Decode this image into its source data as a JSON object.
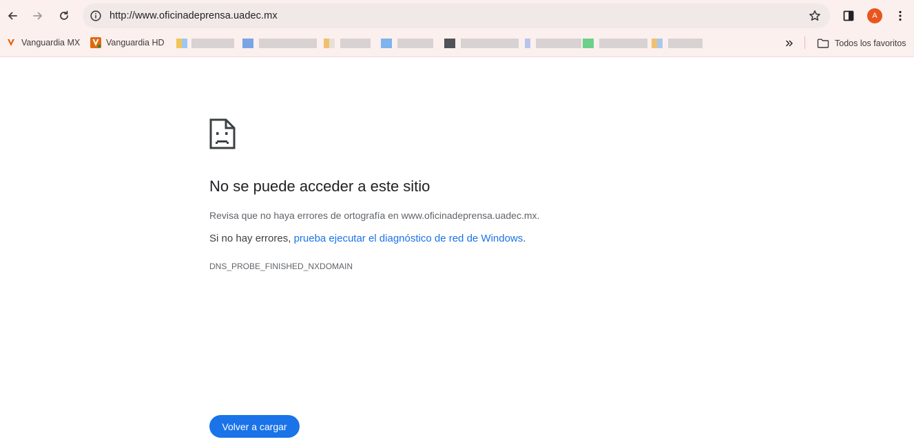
{
  "browser": {
    "url": "http://www.oficinadeprensa.uadec.mx",
    "profile_initial": "A",
    "accent": "#1a73e8",
    "profile_color": "#e8551f"
  },
  "bookmarks": {
    "items": [
      {
        "label": "Vanguardia MX",
        "icon": "vanguardia-v-icon"
      },
      {
        "label": "Vanguardia HD",
        "icon": "vanguardia-hd-icon"
      }
    ],
    "all_favorites_label": "Todos los favoritos"
  },
  "error": {
    "title": "No se puede acceder a este sitio",
    "line1": "Revisa que no haya errores de ortografía en www.oficinadeprensa.uadec.mx.",
    "line2_prefix": "Si no hay errores, ",
    "line2_link": "prueba ejecutar el diagnóstico de red de Windows",
    "line2_suffix": ".",
    "code": "DNS_PROBE_FINISHED_NXDOMAIN",
    "reload_label": "Volver a cargar"
  }
}
